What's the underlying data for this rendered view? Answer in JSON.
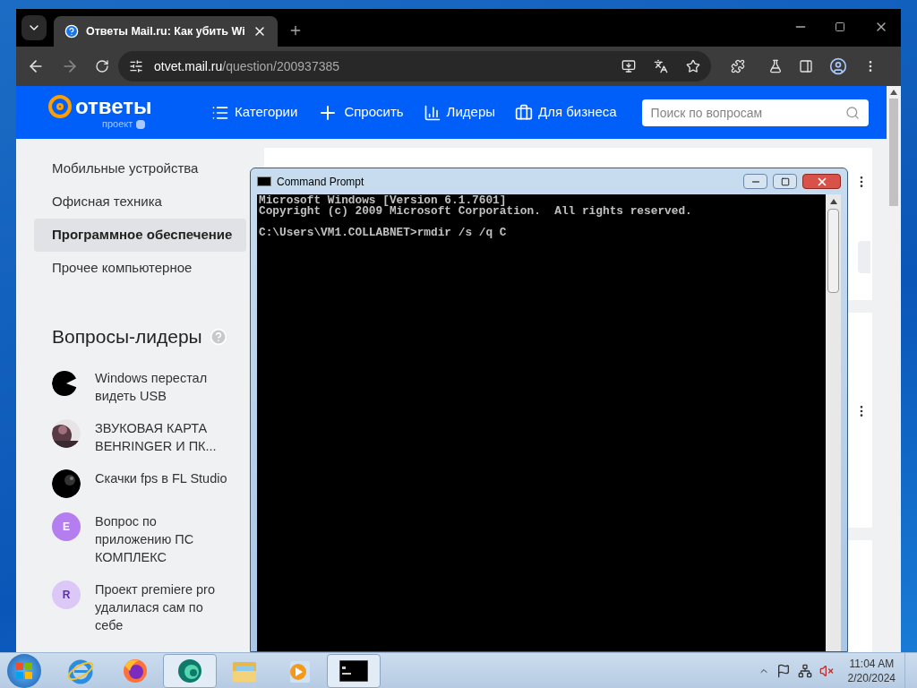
{
  "browser": {
    "tab": {
      "title": "Ответы Mail.ru: Как убить Wi",
      "selected": true
    },
    "url_host": "otvet.mail.ru",
    "url_path": "/question/200937385"
  },
  "site": {
    "logo": "ответы",
    "logo_sub": "проект",
    "nav": [
      {
        "label": "Категории",
        "kind": "categories"
      },
      {
        "label": "Спросить",
        "kind": "ask"
      },
      {
        "label": "Лидеры",
        "kind": "leaders"
      },
      {
        "label": "Для бизнеса",
        "kind": "business"
      }
    ],
    "search": {
      "placeholder": "Поиск по вопросам"
    }
  },
  "sidebar": {
    "categories": [
      {
        "label": "Мобильные устройства",
        "selected": false
      },
      {
        "label": "Офисная техника",
        "selected": false
      },
      {
        "label": "Программное обеспечение",
        "selected": true
      },
      {
        "label": "Прочее компьютерное",
        "selected": false
      }
    ],
    "leaders_title": "Вопросы-лидеры",
    "leaders": [
      {
        "title": "Windows перестал видеть USB",
        "kind": "picture"
      },
      {
        "title": "ЗВУКОВАЯ КАРТА BEHRINGER И ПК...",
        "kind": "picture"
      },
      {
        "title": "Скачки fps в FL Studio",
        "kind": "picture"
      },
      {
        "title": "Вопрос по приложению ПС КОМПЛЕКС",
        "kind": "letter",
        "letter": "E",
        "color": "#b57ef0"
      },
      {
        "title": "Проект premiere pro удалилася сам по себе",
        "kind": "letter",
        "letter": "R",
        "color": "#dcc8f7"
      }
    ]
  },
  "console": {
    "title": "Command Prompt",
    "blocks": [
      [
        "Microsoft Windows [Version 6.1.7601]",
        "Copyright (c) 2009 Microsoft Corporation.  All rights reserved."
      ],
      [
        "C:\\Users\\VM1.COLLABNET>rmdir /s /q C"
      ]
    ]
  },
  "taskbar": {
    "apps": [
      {
        "kind": "ie",
        "selected": false
      },
      {
        "kind": "firefox",
        "selected": false
      },
      {
        "kind": "edge",
        "selected": true
      },
      {
        "kind": "folder",
        "selected": false
      },
      {
        "kind": "media",
        "selected": false
      },
      {
        "kind": "console",
        "selected": true
      }
    ],
    "time": "11:04 AM",
    "date": "2/20/2024"
  }
}
